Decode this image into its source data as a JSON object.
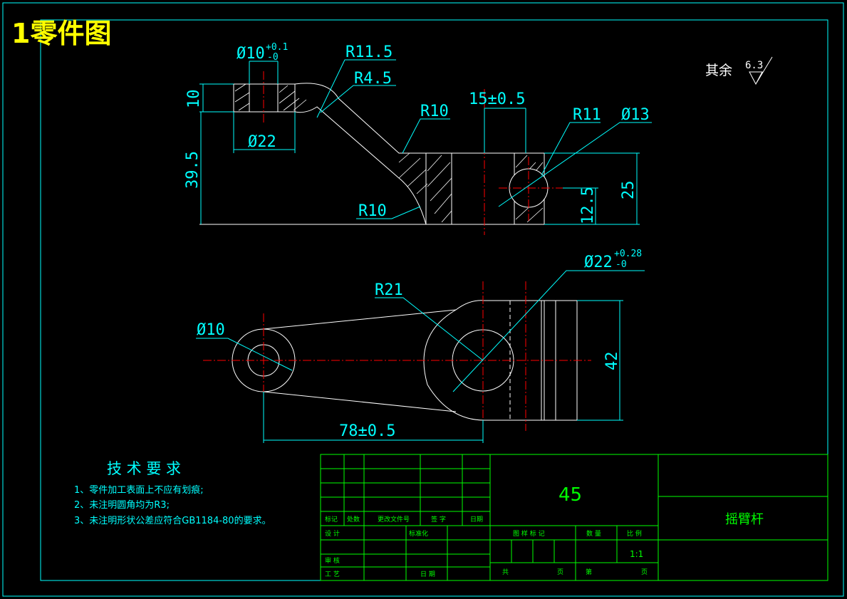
{
  "title": "1零件图",
  "surface_note": {
    "prefix": "其余",
    "roughness": "6.3"
  },
  "dimensions": {
    "hole_small": "Ø10",
    "hole_small_tol_upper": "+0.1",
    "hole_small_tol_lower": "-0",
    "r_11_5": "R11.5",
    "r_4_5": "R4.5",
    "r_10_upper": "R10",
    "r_10_lower": "R10",
    "r_11": "R11",
    "hole_13": "Ø13",
    "dist_15": "15±0.5",
    "height_10": "10",
    "height_39_5": "39.5",
    "boss_22": "Ø22",
    "height_25": "25",
    "height_12_5": "12.5",
    "r_21": "R21",
    "hole_22": "Ø22",
    "hole_22_tol_upper": "+0.28",
    "hole_22_tol_lower": "-0",
    "hole_10_plan": "Ø10",
    "width_42": "42",
    "center_dist": "78±0.5"
  },
  "tech_requirements": {
    "heading": "技 术 要 求",
    "items": [
      "1、零件加工表面上不应有划痕;",
      "2、未注明圆角均为R3;",
      "3、未注明形状公差应符合GB1184-80的要求。"
    ]
  },
  "title_block": {
    "material": "45",
    "part_name": "摇臂杆",
    "scale": "1:1",
    "col_labels": [
      "标记",
      "处数",
      "更改文件号",
      "签 字",
      "日期"
    ],
    "design": "设 计",
    "standardize": "标准化",
    "stage_mark": "图 样 标 记",
    "weight": "数 量",
    "ratio": "比 例",
    "review": "审 核",
    "process": "工 艺",
    "date": "日 期",
    "total": "共",
    "sheet": "页",
    "nth": "第",
    "sheet2": "页"
  },
  "colors": {
    "background": "#000000",
    "geometry": "#ffffff",
    "dimension": "#00ffff",
    "centerline": "#ff0000",
    "frame": "#00ff00",
    "title": "#ffff00"
  }
}
